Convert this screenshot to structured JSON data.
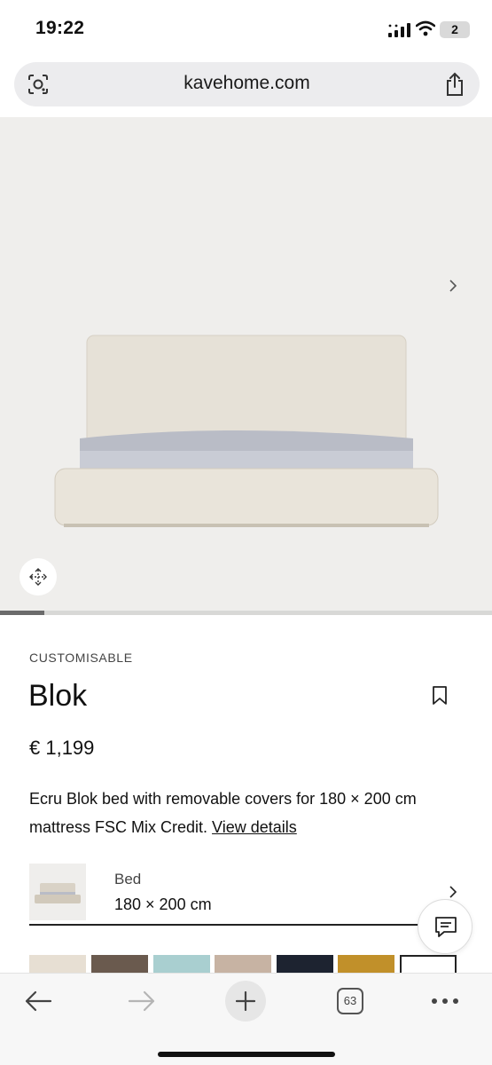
{
  "status_bar": {
    "time": "19:22",
    "battery_level": "2"
  },
  "browser": {
    "url": "kavehome.com",
    "tabs_count": "63"
  },
  "gallery": {
    "progress_fraction": 0.09
  },
  "product": {
    "badge": "CUSTOMISABLE",
    "title": "Blok",
    "price": "€ 1,199",
    "description": "Ecru Blok bed with removable covers for 180 × 200 cm mattress FSC Mix Credit.",
    "details_link": "View details"
  },
  "configurator": {
    "label": "Bed",
    "value": "180 × 200 cm"
  },
  "swatches": [
    {
      "name": "ecru",
      "color": "#e7dfd3"
    },
    {
      "name": "brown",
      "color": "#6a5a4e"
    },
    {
      "name": "light-blue",
      "color": "#a9cfd0"
    },
    {
      "name": "beige",
      "color": "#c7b3a3"
    },
    {
      "name": "navy",
      "color": "#1d2330"
    },
    {
      "name": "mustard",
      "color": "#c1902a"
    }
  ],
  "icons": {
    "lens": "lens-icon",
    "share": "share-icon",
    "next": "chevron-right-icon",
    "view360": "move-icon",
    "bookmark": "bookmark-icon",
    "chat": "chat-icon",
    "back": "arrow-left-icon",
    "forward": "arrow-right-icon",
    "new_tab": "plus-icon",
    "more": "ellipsis-icon"
  }
}
